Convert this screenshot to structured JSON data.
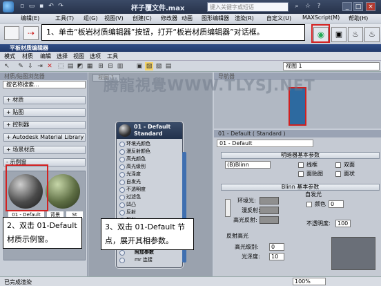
{
  "max_window": {
    "title": "杯子覆文件.max",
    "search_placeholder": "键入关键字或短语",
    "menu": [
      "编辑(E)",
      "工具(T)",
      "组(G)",
      "视图(V)",
      "创建(C)",
      "修改器",
      "动画",
      "图形编辑器",
      "渲染(R)",
      "自定义(U)",
      "MAXScript(M)",
      "帮助(H)"
    ],
    "window_controls": [
      "_",
      "□",
      "×"
    ]
  },
  "slate": {
    "title": "平板材质编辑器",
    "menu": [
      "模式",
      "材质",
      "编辑",
      "选择",
      "视图",
      "选项",
      "工具"
    ],
    "view_dropdown": "视图 1",
    "view_tab": "视图 1",
    "browser_header": "材质/贴图浏览器",
    "search_placeholder": "按名称搜索...",
    "groups": [
      "+ 材质",
      "+ 贴图",
      "+ 控制器",
      "+ Autodesk Material Library",
      "+ 场景材质",
      "- 示例窗"
    ],
    "sample_slots": [
      "01 - Default",
      "背景",
      "St"
    ],
    "navigator_header": "导航器",
    "node": {
      "title_line1": "01 - Default",
      "title_line2": "Standard",
      "slots": [
        "环境光颜色",
        "漫反射颜色",
        "高光颜色",
        "高光级别",
        "光泽度",
        "自发光",
        "不透明度",
        "过滤色",
        "凹凸",
        "反射",
        "折射",
        "置换",
        "附加参数",
        "mr 连接"
      ]
    },
    "params": {
      "header": "01 - Default  ( Standard )",
      "name_value": "01 - Default",
      "rollout1": "明暗器基本参数",
      "shader": "(B)Blinn",
      "checkboxes": [
        "线框",
        "双面",
        "面贴图",
        "面状"
      ],
      "rollout2": "Blinn 基本参数",
      "ambient_label": "环境光:",
      "diffuse_label": "漫反射:",
      "specular_label": "高光反射:",
      "self_illum_label": "自发光",
      "color_label": "颜色",
      "color_value": "0",
      "opacity_label": "不透明度:",
      "opacity_value": "100",
      "spec_group": "反射高光",
      "spec_level_label": "高光级别:",
      "spec_level_value": "0",
      "gloss_label": "光泽度:",
      "gloss_value": "10"
    },
    "status_text": "已完成渲染",
    "zoom": "100%"
  },
  "callouts": {
    "step1": "1、单击“板岩材质编辑器”按钮，打开“板岩材质编辑器”对话框。",
    "step2": "2、双击 01-Default 材质示例窗。",
    "step3": "3、双击 01-Default 节点，展开其相参数。"
  },
  "watermark": "腾龍視覺WWW.TLYSJ.NET"
}
